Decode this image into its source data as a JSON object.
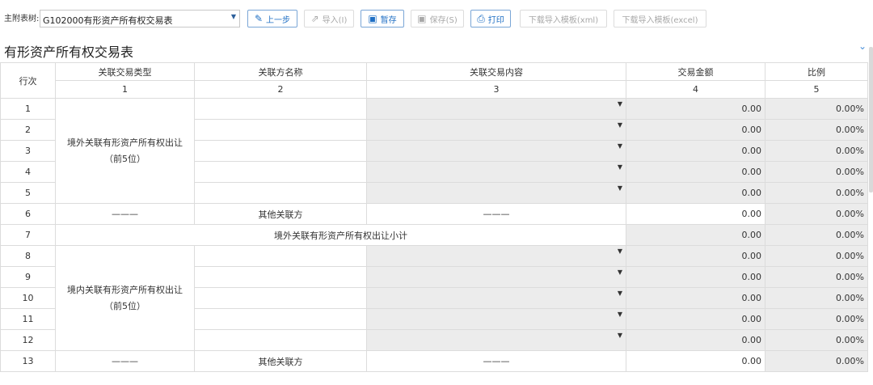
{
  "toolbar": {
    "table_label": "主附表树:",
    "table_select": "G102000有形资产所有权交易表",
    "buttons": [
      {
        "label": "上一步",
        "icon": "edit-icon"
      },
      {
        "label": "导入(I)",
        "icon": "export-icon"
      },
      {
        "label": "暂存",
        "icon": "save-icon"
      },
      {
        "label": "保存(S)",
        "icon": "save-icon"
      },
      {
        "label": "打印",
        "icon": "print-icon"
      },
      {
        "label": "下载导入模板(xml)"
      },
      {
        "label": "下载导入模板(excel)"
      }
    ]
  },
  "title": "有形资产所有权交易表",
  "collapse_icon": "chevron-down-icon",
  "header": {
    "row_label": "行次",
    "columns": [
      "关联交易类型",
      "关联方名称",
      "关联交易内容",
      "交易金额",
      "比例"
    ],
    "column_numbers": [
      "1",
      "2",
      "3",
      "4",
      "5"
    ]
  },
  "group1": {
    "label_line1": "境外关联有形资产所有权出让",
    "label_line2": "（前5位）"
  },
  "group2": {
    "label_line1": "境内关联有形资产所有权出让",
    "label_line2": "（前5位）"
  },
  "dash": "———",
  "other_party": "其他关联方",
  "subtotal_label": "境外关联有形资产所有权出让小计",
  "rows": [
    {
      "no": "1",
      "amount": "0.00",
      "ratio": "0.00%"
    },
    {
      "no": "2",
      "amount": "0.00",
      "ratio": "0.00%"
    },
    {
      "no": "3",
      "amount": "0.00",
      "ratio": "0.00%"
    },
    {
      "no": "4",
      "amount": "0.00",
      "ratio": "0.00%"
    },
    {
      "no": "5",
      "amount": "0.00",
      "ratio": "0.00%"
    },
    {
      "no": "6",
      "amount": "0.00",
      "ratio": "0.00%"
    },
    {
      "no": "7",
      "amount": "0.00",
      "ratio": "0.00%"
    },
    {
      "no": "8",
      "amount": "0.00",
      "ratio": "0.00%"
    },
    {
      "no": "9",
      "amount": "0.00",
      "ratio": "0.00%"
    },
    {
      "no": "10",
      "amount": "0.00",
      "ratio": "0.00%"
    },
    {
      "no": "11",
      "amount": "0.00",
      "ratio": "0.00%"
    },
    {
      "no": "12",
      "amount": "0.00",
      "ratio": "0.00%"
    },
    {
      "no": "13",
      "amount": "0.00",
      "ratio": "0.00%"
    }
  ]
}
